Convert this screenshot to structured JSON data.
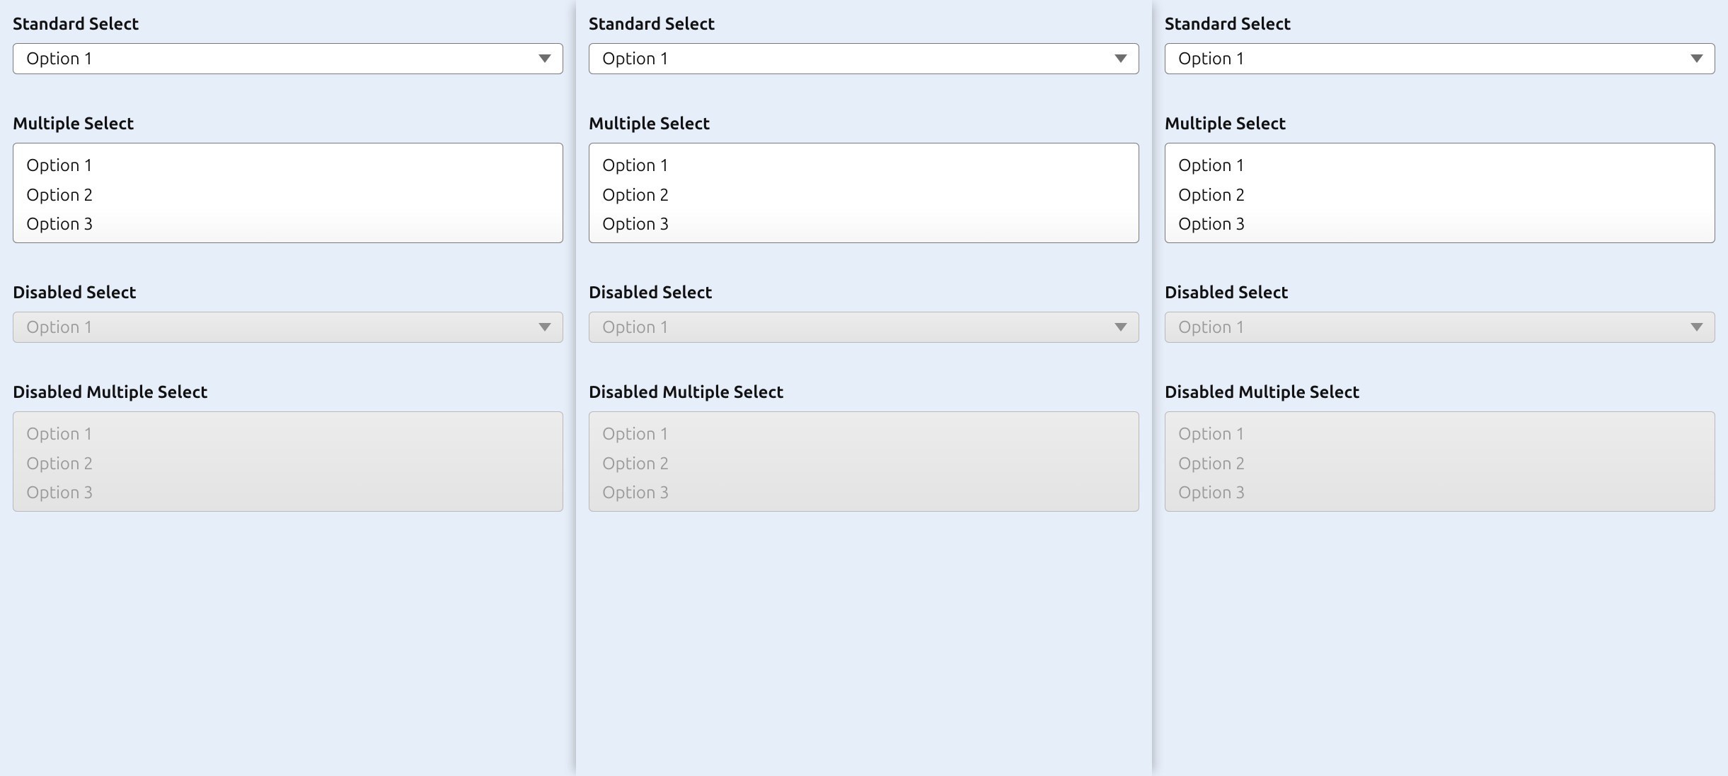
{
  "labels": {
    "standard": "Standard Select",
    "multiple": "Multiple Select",
    "disabled": "Disabled Select",
    "disabled_multiple": "Disabled Multiple Select"
  },
  "options": {
    "opt1": "Option 1",
    "opt2": "Option 2",
    "opt3": "Option 3"
  },
  "selected": {
    "standard": "Option 1",
    "disabled": "Option 1"
  }
}
